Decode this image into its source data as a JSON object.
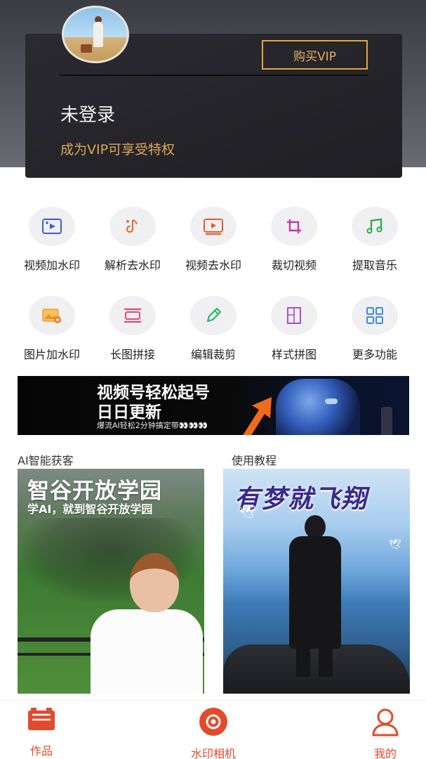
{
  "header": {
    "buy_vip_label": "购买VIP",
    "login_status": "未登录",
    "vip_tip": "成为VIP可享受特权"
  },
  "features": [
    {
      "label": "视频加水印",
      "icon": "video-add-watermark-icon",
      "color": "#3f5ad8"
    },
    {
      "label": "解析去水印",
      "icon": "parse-remove-watermark-icon",
      "color": "#e2703a"
    },
    {
      "label": "视频去水印",
      "icon": "video-remove-watermark-icon",
      "color": "#e25a2c"
    },
    {
      "label": "裁切视频",
      "icon": "crop-video-icon",
      "color": "#c23aa8"
    },
    {
      "label": "提取音乐",
      "icon": "extract-music-icon",
      "color": "#2aa84a"
    },
    {
      "label": "图片加水印",
      "icon": "image-add-watermark-icon",
      "color": "#f0a030"
    },
    {
      "label": "长图拼接",
      "icon": "long-image-stitch-icon",
      "color": "#e24a6a"
    },
    {
      "label": "编辑裁剪",
      "icon": "edit-crop-icon",
      "color": "#2ab86a"
    },
    {
      "label": "样式拼图",
      "icon": "style-collage-icon",
      "color": "#b04ad8"
    },
    {
      "label": "更多功能",
      "icon": "more-functions-icon",
      "color": "#3a8ae0"
    }
  ],
  "banner": {
    "line1": "视频号轻松起号",
    "line2": "日日更新",
    "line3": "爆流AI轻松2分钟搞定带👀👀👀"
  },
  "sections": {
    "left_title": "AI智能获客",
    "right_title": "使用教程",
    "left_poster_title": "智谷开放学园",
    "left_poster_sub": "学AI，就到智谷开放学园",
    "right_poster_title": "有梦就飞翔"
  },
  "bottom_nav": [
    {
      "label": "作品",
      "icon": "works-icon"
    },
    {
      "label": "水印相机",
      "icon": "watermark-camera-icon"
    },
    {
      "label": "我的",
      "icon": "profile-icon"
    }
  ],
  "colors": {
    "accent": "#e24a2c",
    "vip_gold": "#e2a93a"
  }
}
